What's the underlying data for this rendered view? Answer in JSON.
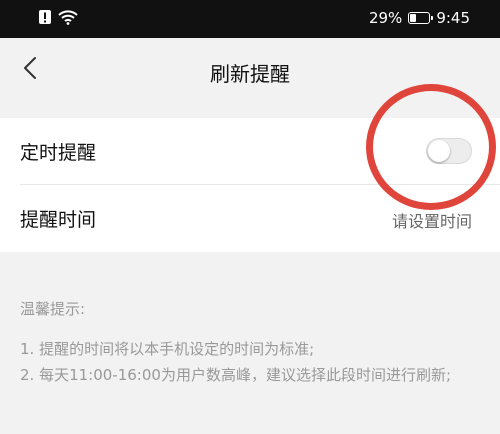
{
  "status_bar": {
    "battery": "29%",
    "time": "9:45",
    "battery_level": 0.29
  },
  "header": {
    "title": "刷新提醒",
    "back_icon": "chevron-left-icon"
  },
  "settings": {
    "scheduled_reminder": {
      "label": "定时提醒",
      "enabled": false
    },
    "reminder_time": {
      "label": "提醒时间",
      "value": "请设置时间"
    }
  },
  "tips": {
    "title": "温馨提示:",
    "items": [
      "1. 提醒的时间将以本手机设定的时间为标准;",
      "2. 每天11:00-16:00为用户数高峰，建议选择此段时间进行刷新;"
    ]
  },
  "colors": {
    "annotation_ring": "#e0453b",
    "status_bar_bg": "#111111"
  }
}
